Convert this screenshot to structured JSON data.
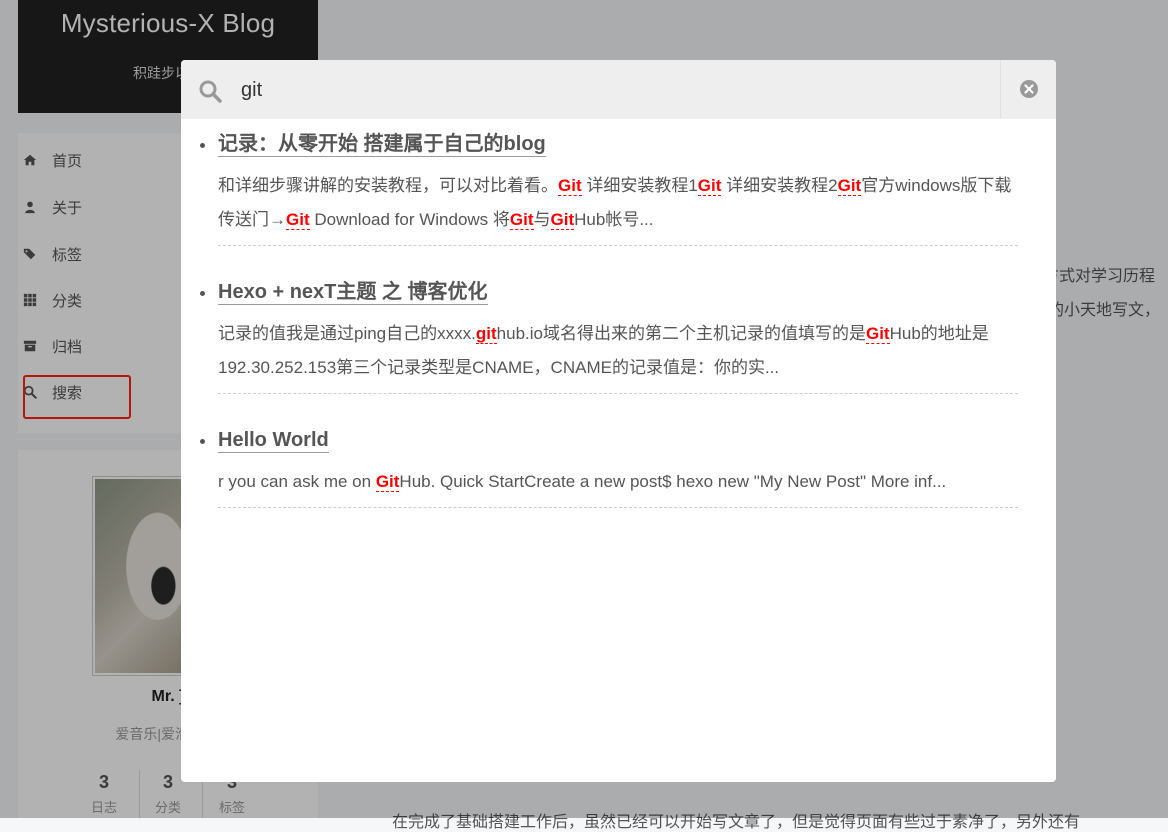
{
  "site": {
    "title": "Mysterious-X Blog",
    "subtitle": "积跬步以至"
  },
  "menu": {
    "items": [
      {
        "label": "首页",
        "icon": "home-icon"
      },
      {
        "label": "关于",
        "icon": "user-icon"
      },
      {
        "label": "标签",
        "icon": "tags-icon"
      },
      {
        "label": "分类",
        "icon": "grid-icon"
      },
      {
        "label": "归档",
        "icon": "archive-icon"
      },
      {
        "label": "搜索",
        "icon": "search-icon"
      }
    ]
  },
  "sidebar": {
    "author_name": "Mr. ]",
    "author_desc": "爱音乐|爱滑雪|爱",
    "stats": [
      {
        "count": "3",
        "name": "日志"
      },
      {
        "count": "3",
        "name": "分类"
      },
      {
        "count": "3",
        "name": "标签"
      }
    ]
  },
  "main": {
    "frag1": "方式对学习历程",
    "frag2": "的小天地写文，",
    "frag3": "在完成了基础搭建工作后，虽然已经可以开始写文章了，但是觉得页面有些过于素净了，另外还有"
  },
  "search": {
    "query": "git",
    "results": [
      {
        "title": "记录：从零开始 搭建属于自己的blog",
        "excerpt": [
          {
            "t": "和详细步骤讲解的安装教程，可以对比着看。"
          },
          {
            "t": "Git",
            "kw": true
          },
          {
            "t": " 详细安装教程1"
          },
          {
            "t": "Git",
            "kw": true
          },
          {
            "t": " 详细安装教程2"
          },
          {
            "t": "Git",
            "kw": true
          },
          {
            "t": "官方windows版下载传送门→"
          },
          {
            "t": "Git",
            "kw": true
          },
          {
            "t": " Download for Windows 将"
          },
          {
            "t": "Git",
            "kw": true
          },
          {
            "t": "与"
          },
          {
            "t": "Git",
            "kw": true
          },
          {
            "t": "Hub帐号..."
          }
        ]
      },
      {
        "title": "Hexo + nexT主题 之 博客优化",
        "excerpt": [
          {
            "t": "记录的值我是通过ping自己的xxxx."
          },
          {
            "t": "git",
            "kw": true
          },
          {
            "t": "hub.io域名得出来的第二个主机记录的值填写的是"
          },
          {
            "t": "Git",
            "kw": true
          },
          {
            "t": "Hub的地址是192.30.252.153第三个记录类型是CNAME，CNAME的记录值是：你的实..."
          }
        ]
      },
      {
        "title": "Hello World",
        "excerpt": [
          {
            "t": "r you can ask me on "
          },
          {
            "t": "Git",
            "kw": true
          },
          {
            "t": "Hub. Quick StartCreate a new post$ hexo new \"My New Post\" More inf..."
          }
        ]
      }
    ]
  }
}
